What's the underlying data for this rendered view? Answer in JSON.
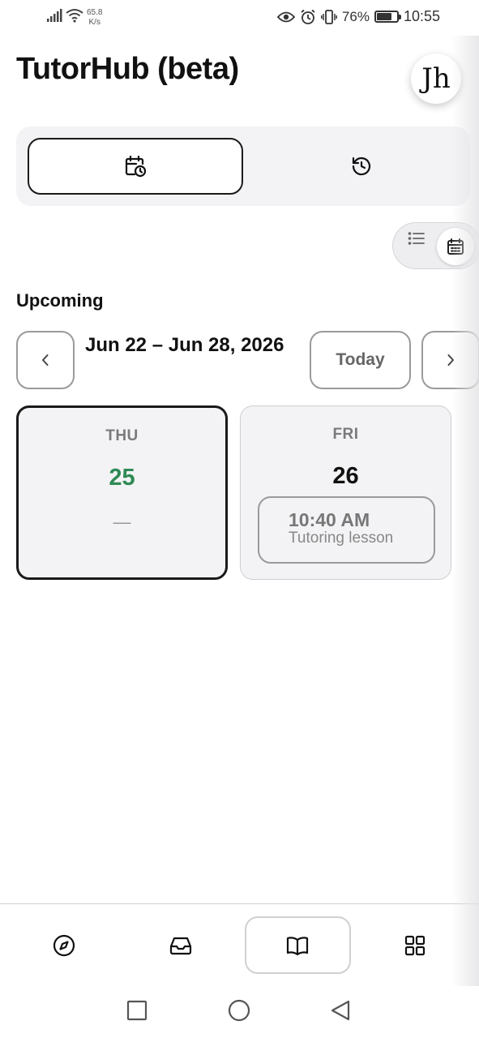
{
  "status_bar": {
    "net_speed_value": "65.8",
    "net_speed_unit": "K/s",
    "battery_percent": "76%",
    "battery_level": 0.76,
    "time": "10:55"
  },
  "header": {
    "app_title": "TutorHub (beta)",
    "avatar_initials": "Jh"
  },
  "tabs": [
    {
      "icon": "calendar-clock-icon",
      "active": true
    },
    {
      "icon": "history-icon",
      "active": false
    }
  ],
  "view_toggle": {
    "options": [
      "list-icon",
      "calendar-icon"
    ],
    "selected": "calendar-icon"
  },
  "schedule": {
    "section_title": "Upcoming",
    "date_range": "Jun 22 – Jun 28, 2026",
    "today_label": "Today",
    "days": [
      {
        "dow": "THU",
        "date": "25",
        "empty": "—",
        "selected": true,
        "is_today": true
      },
      {
        "dow": "FRI",
        "date": "26",
        "selected": false,
        "is_today": false,
        "lessons": [
          {
            "time": "10:40 AM",
            "title": "Tutoring lesson"
          }
        ]
      }
    ]
  },
  "bottom_nav": {
    "items": [
      "compass-icon",
      "inbox-icon",
      "book-open-icon",
      "grid-icon"
    ],
    "active": "book-open-icon"
  },
  "colors": {
    "accent_green": "#2f8a55",
    "surface": "#f3f3f5",
    "border_dark": "#1a1a1a"
  }
}
